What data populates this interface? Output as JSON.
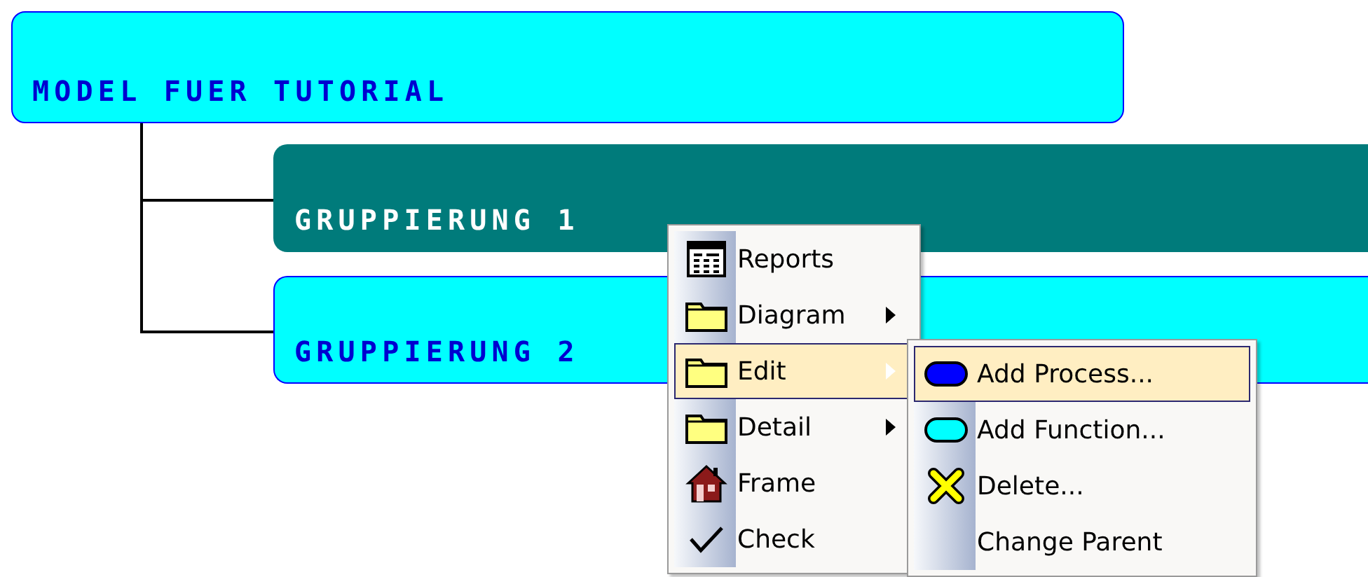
{
  "diagram": {
    "root": {
      "label": "MODEL FUER TUTORIAL",
      "selected": false,
      "children": [
        {
          "label": "GRUPPIERUNG 1",
          "selected": true
        },
        {
          "label": "GRUPPIERUNG 2",
          "selected": false
        }
      ]
    }
  },
  "context_menu": {
    "items": [
      {
        "label": "Reports",
        "kind": "report",
        "submenu": false,
        "selected": false
      },
      {
        "label": "Diagram",
        "kind": "folder",
        "submenu": true,
        "selected": false
      },
      {
        "label": "Edit",
        "kind": "folder",
        "submenu": true,
        "selected": true
      },
      {
        "label": "Detail",
        "kind": "folder",
        "submenu": true,
        "selected": false
      },
      {
        "label": "Frame",
        "kind": "house",
        "submenu": false,
        "selected": false
      },
      {
        "label": "Check",
        "kind": "check",
        "submenu": false,
        "selected": false
      }
    ]
  },
  "submenu": {
    "items": [
      {
        "label": "Add Process...",
        "kind": "process",
        "selected": true
      },
      {
        "label": "Add Function...",
        "kind": "function",
        "selected": false
      },
      {
        "label": "Delete...",
        "kind": "delete",
        "selected": false
      },
      {
        "label": "Change Parent",
        "kind": "plain",
        "selected": false
      }
    ]
  }
}
